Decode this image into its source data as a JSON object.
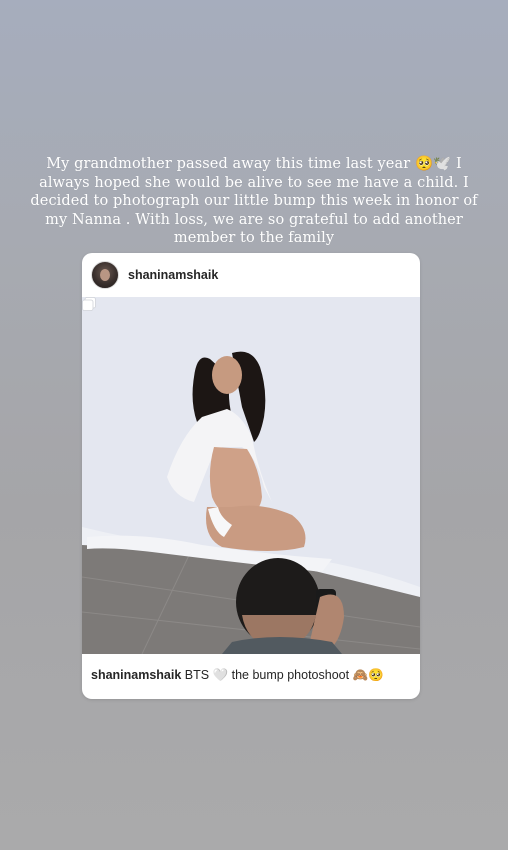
{
  "story": {
    "text": "My grandmother passed away this time last year 🥺🕊️ I always hoped she would be alive to see me have a child. I decided to photograph our little bump this week in honor of my Nanna . With loss, we are so grateful to add another member to the family"
  },
  "post": {
    "username": "shaninamshaik",
    "caption_username": "shaninamshaik",
    "caption_text": " BTS 🤍 the bump photoshoot 🙈🥺",
    "avatar_icon": "profile-avatar",
    "multi_image_icon": "carousel-icon"
  }
}
